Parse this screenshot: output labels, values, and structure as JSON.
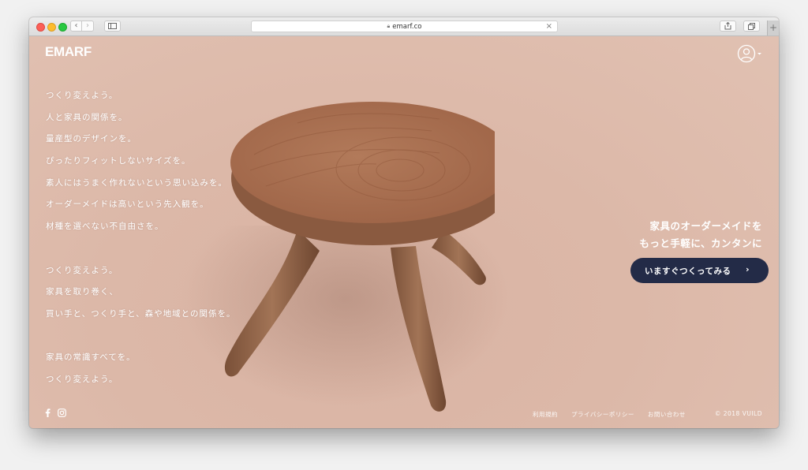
{
  "browser": {
    "url": "emarf.co",
    "icons": [
      "back-icon",
      "forward-icon",
      "sidebar-icon",
      "lock-icon",
      "close-icon",
      "share-icon",
      "tabs-icon",
      "new-tab-icon"
    ]
  },
  "header": {
    "logo": "EMARF",
    "account_icon": "account-circle-icon"
  },
  "poem": {
    "stanza1": [
      "つくり変えよう。",
      "人と家具の関係を。",
      "量産型のデザインを。",
      "ぴったりフィットしないサイズを。",
      "素人にはうまく作れないという思い込みを。",
      "オーダーメイドは高いという先入観を。",
      "材種を選べない不自由さを。"
    ],
    "stanza2": [
      "つくり変えよう。",
      "家具を取り巻く、",
      "買い手と、つくり手と、森や地域との関係を。"
    ],
    "stanza3": [
      "家具の常識すべてを。",
      "つくり変えよう。"
    ]
  },
  "hero": {
    "tagline_line1": "家具のオーダーメイドを",
    "tagline_line2": "もっと手軽に、カンタンに",
    "cta_label": "いますぐつくってみる",
    "cta_arrow": "›"
  },
  "footer": {
    "social": [
      "facebook-icon",
      "instagram-icon"
    ],
    "terms": "利用規約",
    "privacy": "プライバシーポリシー",
    "contact": "お問い合わせ",
    "copyright": "© 2018 VUILD"
  },
  "colors": {
    "background": "#dbb8a8",
    "cta": "#232b47",
    "text": "#ffffff"
  }
}
